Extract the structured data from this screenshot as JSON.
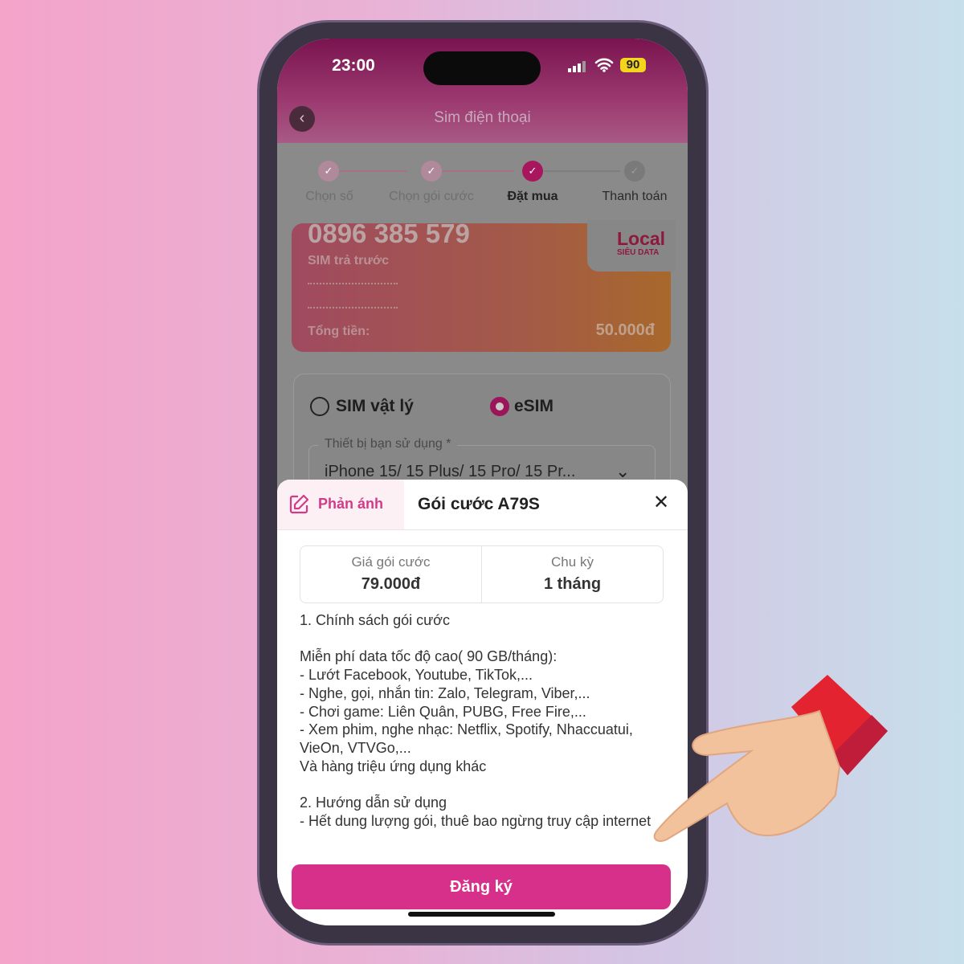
{
  "status_bar": {
    "time": "23:00",
    "battery": "90"
  },
  "header": {
    "title": "Sim điện thoại"
  },
  "stepper": {
    "steps": [
      {
        "label": "Chọn số"
      },
      {
        "label": "Chọn gói cước"
      },
      {
        "label": "Đặt mua"
      },
      {
        "label": "Thanh toán"
      }
    ],
    "active_index": 2
  },
  "sim_card": {
    "number": "0896 385 579",
    "type": "SIM trả trước",
    "total_label": "Tổng tiền:",
    "total_value": "50.000đ",
    "brand": "Local",
    "brand_sub": "SIÊU DATA"
  },
  "sim_type": {
    "options": [
      "SIM vật lý",
      "eSIM"
    ],
    "selected": "eSIM"
  },
  "device": {
    "label": "Thiết bị bạn sử dụng *",
    "value": "iPhone 15/ 15 Plus/ 15 Pro/ 15 Pr..."
  },
  "sheet": {
    "feedback_label": "Phản ánh",
    "title": "Gói cước A79S",
    "price_label": "Giá gói cước",
    "price_value": "79.000đ",
    "cycle_label": "Chu kỳ",
    "cycle_value": "1 tháng",
    "description": "1. Chính sách gói cước\n\nMiễn phí data tốc độ cao( 90 GB/tháng):\n- Lướt Facebook, Youtube, TikTok,...\n- Nghe, gọi, nhắn tin: Zalo, Telegram, Viber,...\n- Chơi game: Liên Quân, PUBG, Free Fire,...\n- Xem phim, nghe nhạc: Netflix, Spotify, Nhaccuatui, VieOn, VTVGo,...\nVà hàng triệu ứng dụng khác\n\n2. Hướng dẫn sử dụng\n- Hết dung lượng gói, thuê bao ngừng truy cập internet",
    "register_label": "Đăng ký"
  },
  "colors": {
    "accent": "#d6308a",
    "brand": "#b5174f"
  }
}
